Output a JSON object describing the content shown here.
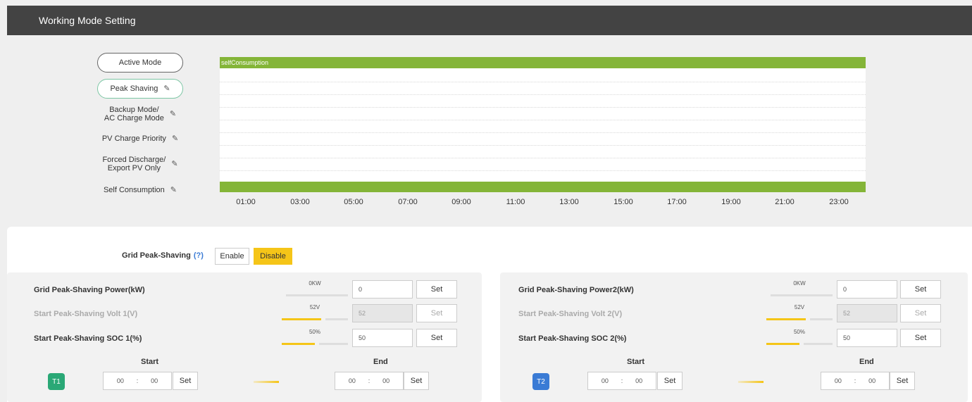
{
  "header": {
    "title": "Working Mode Setting"
  },
  "modes": {
    "active": "Active Mode",
    "peak_shaving": "Peak Shaving",
    "backup_line1": "Backup Mode/",
    "backup_line2": "AC Charge Mode",
    "pv_charge": "PV Charge Priority",
    "forced_line1": "Forced Discharge/",
    "forced_line2": "Export PV Only",
    "self_consumption": "Self Consumption"
  },
  "chart": {
    "top_bar_label": "selfConsumption",
    "bar_color": "#84b538",
    "ticks": [
      "01:00",
      "03:00",
      "05:00",
      "07:00",
      "09:00",
      "11:00",
      "13:00",
      "15:00",
      "17:00",
      "19:00",
      "21:00",
      "23:00"
    ]
  },
  "grid_peak_shaving": {
    "label": "Grid Peak-Shaving",
    "help": "(?)",
    "enable": "Enable",
    "disable": "Disable",
    "active_color": "#f5c518"
  },
  "panel1": {
    "power_label": "Grid Peak-Shaving Power(kW)",
    "power_slider": "0KW",
    "power_level": 0,
    "power_value": "0",
    "volt_label": "Start Peak-Shaving Volt 1(V)",
    "volt_slider": "52V",
    "volt_level": 0.6,
    "volt_value": "52",
    "soc_label": "Start Peak-Shaving SOC 1(%)",
    "soc_slider": "50%",
    "soc_level": 0.5,
    "soc_value": "50",
    "set": "Set",
    "start": "Start",
    "end": "End",
    "badge": "T1",
    "badge_color": "#2aa876",
    "start_hh": "00",
    "start_mm": "00",
    "end_hh": "00",
    "end_mm": "00",
    "colon": ":"
  },
  "panel2": {
    "power_label": "Grid Peak-Shaving Power2(kW)",
    "power_slider": "0KW",
    "power_level": 0,
    "power_value": "0",
    "volt_label": "Start Peak-Shaving Volt 2(V)",
    "volt_slider": "52V",
    "volt_level": 0.6,
    "volt_value": "52",
    "soc_label": "Start Peak-Shaving SOC 2(%)",
    "soc_slider": "50%",
    "soc_level": 0.5,
    "soc_value": "50",
    "set": "Set",
    "start": "Start",
    "end": "End",
    "badge": "T2",
    "badge_color": "#3a7bd5",
    "start_hh": "00",
    "start_mm": "00",
    "end_hh": "00",
    "end_mm": "00",
    "colon": ":"
  }
}
